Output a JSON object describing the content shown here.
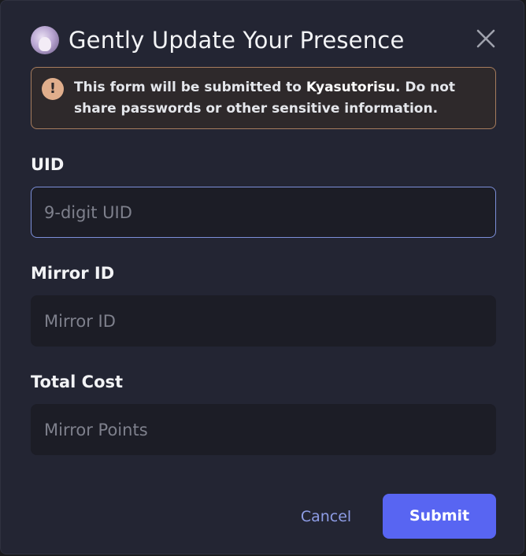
{
  "dialog": {
    "title": "Gently Update Your Presence",
    "close_icon": "close-icon",
    "avatar_icon": "app-avatar"
  },
  "notice": {
    "icon": "exclamation-icon",
    "prefix": "This form will be submitted to ",
    "app_name": "Kyasutorisu",
    "suffix": ". Do not share passwords or other sensitive information."
  },
  "fields": [
    {
      "label": "UID",
      "placeholder": "9-digit UID",
      "value": ""
    },
    {
      "label": "Mirror ID",
      "placeholder": "Mirror ID",
      "value": ""
    },
    {
      "label": "Total Cost",
      "placeholder": "Mirror Points",
      "value": ""
    }
  ],
  "actions": {
    "cancel_label": "Cancel",
    "submit_label": "Submit"
  },
  "colors": {
    "accent": "#5865f2",
    "warning_border": "#a77d5e",
    "background": "#232533"
  }
}
